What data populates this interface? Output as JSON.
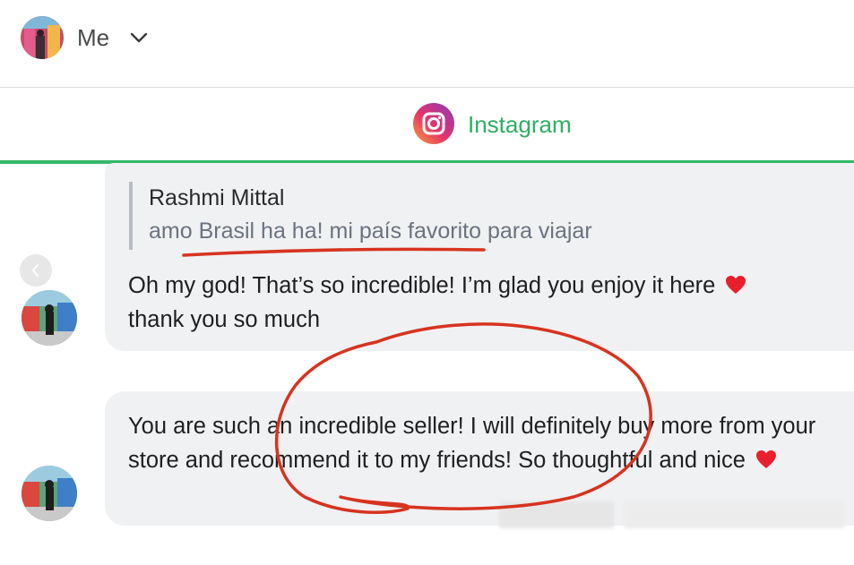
{
  "header": {
    "user_label": "Me",
    "avatar_icon": "profile-avatar",
    "dropdown_icon": "chevron-down-icon"
  },
  "tab": {
    "label": "Instagram",
    "icon": "instagram-icon",
    "accent_color": "#36b66a"
  },
  "messages": [
    {
      "reply_to": {
        "author": "Rashmi Mittal",
        "text": "amo Brasil ha ha! mi país favorito para viajar"
      },
      "text": "Oh my god! That’s so incredible! I’m glad you enjoy it here",
      "text_line2": "thank you so much",
      "emoji": "heart-emoji"
    },
    {
      "text": "You are such an incredible seller! I will definitely buy more from your store and recommend it to my friends! So thoughtful and nice",
      "emoji": "heart-emoji"
    }
  ],
  "annotation_color": "#d7331f"
}
